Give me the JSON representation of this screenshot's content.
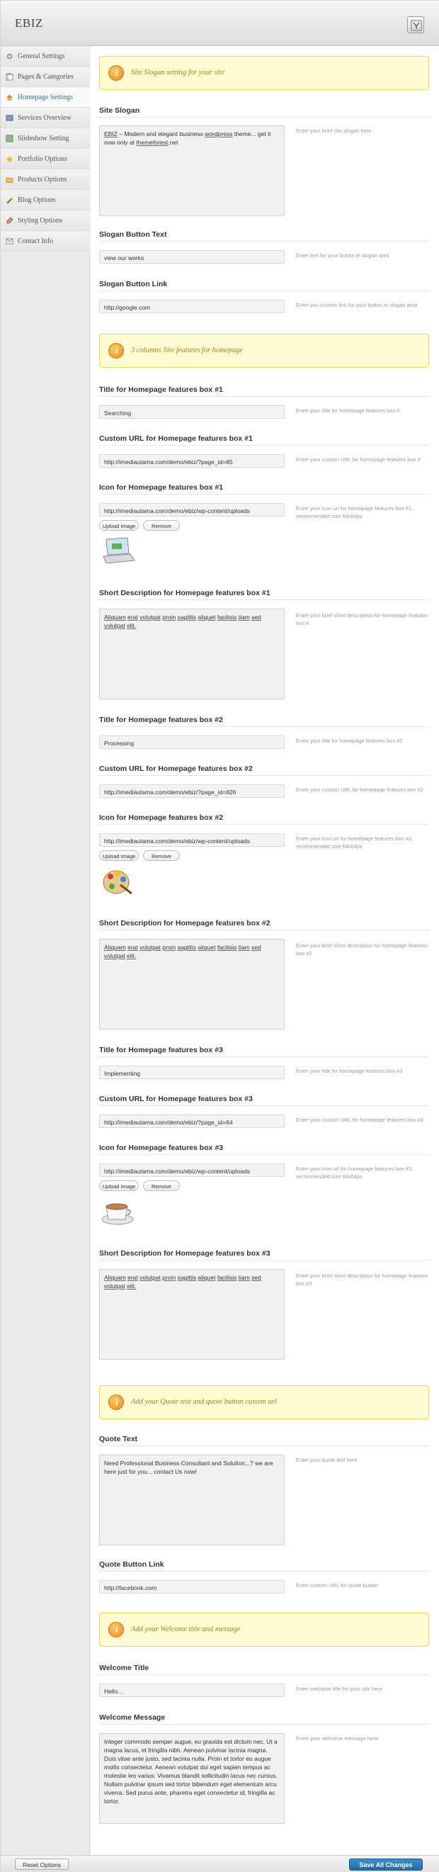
{
  "header": {
    "brand": "EBIZ"
  },
  "sidebar": {
    "items": [
      {
        "label": "General Settings",
        "icon": "gear-icon",
        "active": false
      },
      {
        "label": "Pages & Categories",
        "icon": "pages-icon",
        "active": false
      },
      {
        "label": "Homepage Settings",
        "icon": "home-icon",
        "active": true
      },
      {
        "label": "Services Overview",
        "icon": "services-icon",
        "active": false
      },
      {
        "label": "Slideshow Setting",
        "icon": "slideshow-icon",
        "active": false
      },
      {
        "label": "Portfolio Options",
        "icon": "star-icon",
        "active": false
      },
      {
        "label": "Products Options",
        "icon": "folder-icon",
        "active": false
      },
      {
        "label": "Blog Options",
        "icon": "pencil-icon",
        "active": false
      },
      {
        "label": "Styling Options",
        "icon": "brush-icon",
        "active": false
      },
      {
        "label": "Contact Info",
        "icon": "contact-icon",
        "active": false
      }
    ]
  },
  "banners": {
    "slogan": "Site Slogan setting for your site",
    "features": "3 columns Site features for homepage",
    "quote": "Add your Quote text and quote button custom url",
    "welcome": "Add your Welcome title and message"
  },
  "slogan": {
    "title": "Site Slogan",
    "value_parts": [
      "EBIZ",
      " – Modern and elegant business ",
      "wordpress",
      " theme... get it now only at ",
      "themeforest",
      ".net"
    ],
    "help": "Enter your brief site slogan here"
  },
  "slogan_button_text": {
    "title": "Slogan Button Text",
    "value": "view our works",
    "help": "Enter text for your button in slogan area"
  },
  "slogan_button_link": {
    "title": "Slogan Button Link",
    "value": "http://google.com",
    "help": "Enter you custom link for your button in slogan area"
  },
  "upload_label": "Upload Image",
  "remove_label": "Remove",
  "features": [
    {
      "title_label": "Title for Homepage features box #1",
      "title_value": "Searching",
      "title_help": "Enter your title for homepage features box #",
      "url_label": "Custom URL for Homepage features box #1",
      "url_value": "http://imediautama.com/demo/ebiz/?page_id=85",
      "url_help": "Enter your custom URL for homepage features box #",
      "icon_label": "Icon for Homepage features box #1",
      "icon_value": "http://imediautama.com/demo/ebiz/wp-content/uploads",
      "icon_help": "Enter your icon url for homepage features box #1, recommended size 64x64px",
      "icon_image": "laptop-icon",
      "desc_label": "Short Description for Homepage features box #1",
      "desc_words": [
        "Aliquam",
        "erat",
        "volutpat",
        "proin",
        "sagittis",
        "aliquet",
        "facilisis",
        "tiam",
        "sed",
        "volutpat",
        "elit."
      ],
      "desc_help": "Enter your brief short description for homepage features box #"
    },
    {
      "title_label": "Title for Homepage features box #2",
      "title_value": "Processing",
      "title_help": "Enter your title for homepage features box #2",
      "url_label": "Custom URL for Homepage features box #2",
      "url_value": "http://imediautama.com/demo/ebiz/?page_id=826",
      "url_help": "Enter your custom URL for homepage features box #2",
      "icon_label": "Icon for Homepage features box #2",
      "icon_value": "http://imediautama.com/demo/ebiz/wp-content/uploads",
      "icon_help": "Enter your icon url for homepage features box #2, recommended size 64x64px",
      "icon_image": "palette-icon",
      "desc_label": "Short Description for Homepage features box #2",
      "desc_words": [
        "Aliquam",
        "erat",
        "volutpat",
        "proin",
        "sagittis",
        "aliquet",
        "facilisis",
        "tiam",
        "sed",
        "volutpat",
        "elit."
      ],
      "desc_help": "Enter your brief short description for homepage features box #2"
    },
    {
      "title_label": "Title for Homepage features box #3",
      "title_value": "Implementing",
      "title_help": "Enter your title for homepage features box #3",
      "url_label": "Custom URL for Homepage features box #3",
      "url_value": "http://imediautama.com/demo/ebiz/?page_id=64",
      "url_help": "Enter your custom URL for homepage features box #3",
      "icon_label": "Icon for Homepage features box #3",
      "icon_value": "http://imediautama.com/demo/ebiz/wp-content/uploads",
      "icon_help": "Enter your icon url for homepage features box #3, recommended size 64x64px",
      "icon_image": "coffee-cup-icon",
      "desc_label": "Short Description for Homepage features box #3",
      "desc_words": [
        "Aliquam",
        "erat",
        "volutpat",
        "proin",
        "sagittis",
        "aliquet",
        "facilisis",
        "tiam",
        "sed",
        "volutpat",
        "elit."
      ],
      "desc_help": "Enter your brief short description for homepage features box #3"
    }
  ],
  "quote_text": {
    "title": "Quote Text",
    "value": "Need Professional Business Consultant and Solution...? we are here just for you... contact Us now!",
    "help": "Enter your quote text here"
  },
  "quote_button_link": {
    "title": "Quote Button Link",
    "value": "http://facebook.com",
    "help": "Enter custom URL for quote button"
  },
  "welcome_title": {
    "title": "Welcome Title",
    "value": "Hello...",
    "help": "Enter welcome title for your site here"
  },
  "welcome_message": {
    "title": "Welcome Message",
    "value": "Integer commodo semper augue, eu gravida est dictum nec. Ut a magna lacus, et fringilla nibh. Aenean pulvinar lacinia magna. Duis vitae ante justo, sed lacinia nulla. Proin et tortor eu augue mollis consectetur. Aenean volutpat dui eget sapien tempus ac molestie leo varius. Vivamus blandit sollicitudin lacus nec cursus. Nullam pulvinar ipsum sed tortor bibendum eget elementum arcu viverra. Sed purus ante, pharetra eget consectetur id, fringilla ac tortor.",
    "help": "Enter your welcome message here"
  },
  "footer": {
    "reset_label": "Reset Options",
    "save_label": "Save All Changes"
  },
  "colors": {
    "accent": "#2a6fb0",
    "banner_bg": "#fffbd3",
    "banner_text": "#b07a1a",
    "save_button": "#1f6aa8"
  }
}
